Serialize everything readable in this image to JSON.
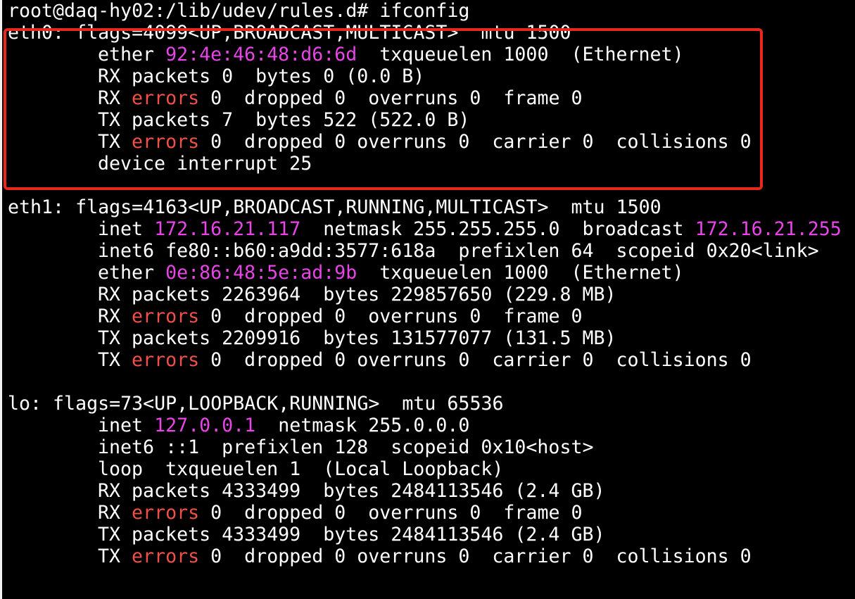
{
  "prompt": "root@daq-hy02:/lib/udev/rules.d# ifconfig",
  "colors": {
    "background": "#000000",
    "text": "#ffffff",
    "address": "#e844e8",
    "error": "#f0504a",
    "highlight": "#e8271f"
  },
  "eth0": {
    "header": "eth0: flags=4099<UP,BROADCAST,MULTICAST>  mtu 1500",
    "ether_pre": "ether ",
    "ether_addr": "92:4e:46:48:d6:6d",
    "ether_post": "  txqueuelen 1000  (Ethernet)",
    "rx_packets": "RX packets 0  bytes 0 (0.0 B)",
    "rx_err_pre": "RX ",
    "rx_err_word": "errors",
    "rx_err_post": " 0  dropped 0  overruns 0  frame 0",
    "tx_packets": "TX packets 7  bytes 522 (522.0 B)",
    "tx_err_pre": "TX ",
    "tx_err_word": "errors",
    "tx_err_post": " 0  dropped 0 overruns 0  carrier 0  collisions 0",
    "device": "device interrupt 25"
  },
  "eth1": {
    "header": "eth1: flags=4163<UP,BROADCAST,RUNNING,MULTICAST>  mtu 1500",
    "inet_pre": "inet ",
    "inet_addr": "172.16.21.117",
    "inet_mid": "  netmask 255.255.255.0  broadcast ",
    "broadcast_addr": "172.16.21.255",
    "inet6": "inet6 fe80::b60:a9dd:3577:618a  prefixlen 64  scopeid 0x20<link>",
    "ether_pre": "ether ",
    "ether_addr": "0e:86:48:5e:ad:9b",
    "ether_post": "  txqueuelen 1000  (Ethernet)",
    "rx_packets": "RX packets 2263964  bytes 229857650 (229.8 MB)",
    "rx_err_pre": "RX ",
    "rx_err_word": "errors",
    "rx_err_post": " 0  dropped 0  overruns 0  frame 0",
    "tx_packets": "TX packets 2209916  bytes 131577077 (131.5 MB)",
    "tx_err_pre": "TX ",
    "tx_err_word": "errors",
    "tx_err_post": " 0  dropped 0 overruns 0  carrier 0  collisions 0"
  },
  "lo": {
    "header": "lo: flags=73<UP,LOOPBACK,RUNNING>  mtu 65536",
    "inet_pre": "inet ",
    "inet_addr": "127.0.0.1",
    "inet_post": "  netmask 255.0.0.0",
    "inet6": "inet6 ::1  prefixlen 128  scopeid 0x10<host>",
    "loop": "loop  txqueuelen 1  (Local Loopback)",
    "rx_packets": "RX packets 4333499  bytes 2484113546 (2.4 GB)",
    "rx_err_pre": "RX ",
    "rx_err_word": "errors",
    "rx_err_post": " 0  dropped 0  overruns 0  frame 0",
    "tx_packets": "TX packets 4333499  bytes 2484113546 (2.4 GB)",
    "tx_err_pre": "TX ",
    "tx_err_word": "errors",
    "tx_err_post": " 0  dropped 0 overruns 0  carrier 0  collisions 0"
  }
}
